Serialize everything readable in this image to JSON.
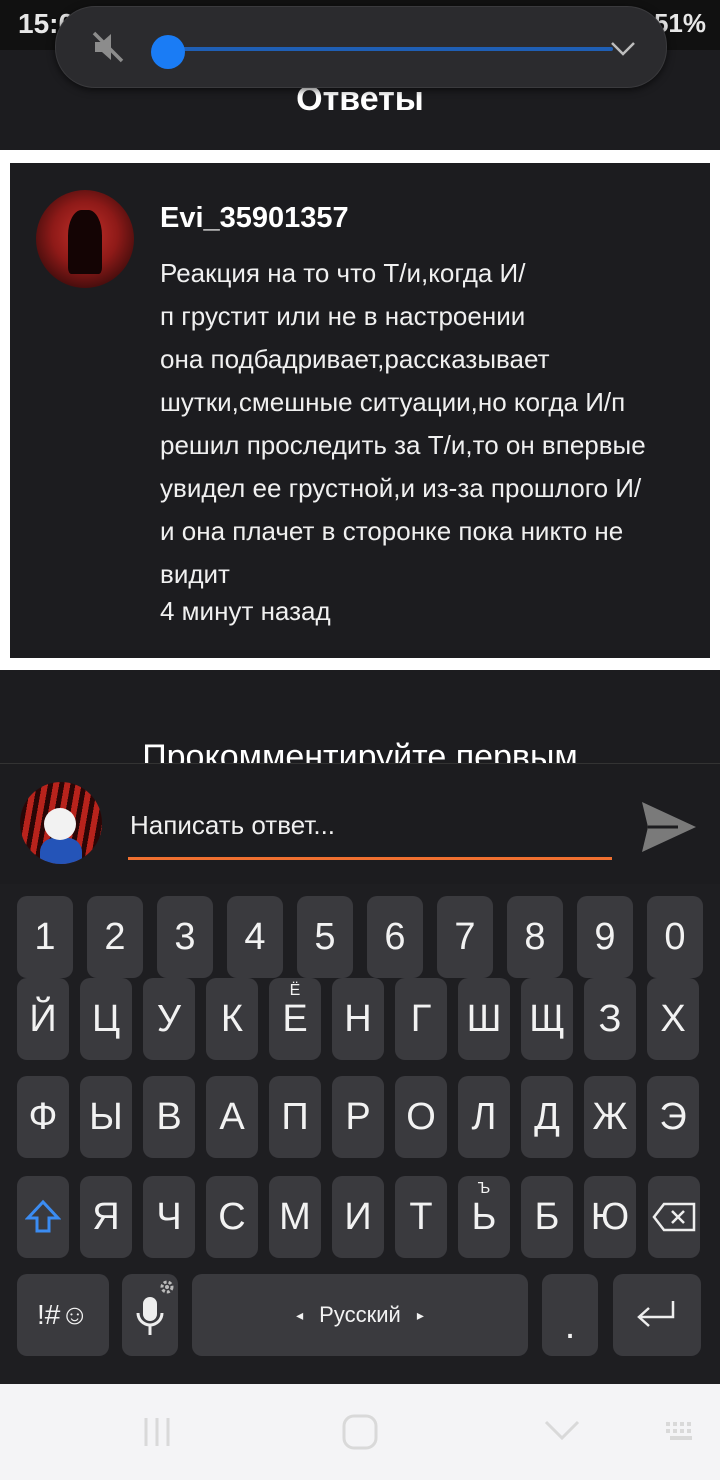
{
  "status_bar": {
    "time": "15:01",
    "battery": "51%"
  },
  "header": {
    "title": "Ответы"
  },
  "volume_popup": {
    "level_fraction": 0.0
  },
  "reply": {
    "username": "Evi_35901357",
    "text": "Реакция на то что Т/и,когда И/\nп грустит или не в настроении\nона подбадривает,рассказывает\nшутки,смешные ситуации,но когда И/п\nрешил проследить за Т/и,то он впервые\nувидел ее грустной,и из-за прошлого И/\nи она плачет в сторонке пока никто не\nвидит",
    "timestamp": "4 минут назад"
  },
  "empty_comments_text": "Прокомментируйте первым",
  "reply_input": {
    "placeholder": "Написать ответ...",
    "value": ""
  },
  "keyboard": {
    "row_numbers": [
      "1",
      "2",
      "3",
      "4",
      "5",
      "6",
      "7",
      "8",
      "9",
      "0"
    ],
    "row1": [
      "Й",
      "Ц",
      "У",
      "К",
      "Е",
      "Н",
      "Г",
      "Ш",
      "Щ",
      "З",
      "Х"
    ],
    "row1_sup": {
      "4": "Ё"
    },
    "row2": [
      "Ф",
      "Ы",
      "В",
      "А",
      "П",
      "Р",
      "О",
      "Л",
      "Д",
      "Ж",
      "Э"
    ],
    "row3": [
      "Я",
      "Ч",
      "С",
      "М",
      "И",
      "Т",
      "Ь",
      "Б",
      "Ю"
    ],
    "row3_sup": {
      "6": "Ъ"
    },
    "symbols_label": "!#☺",
    "space_label": "Русский",
    "period_label": "."
  }
}
